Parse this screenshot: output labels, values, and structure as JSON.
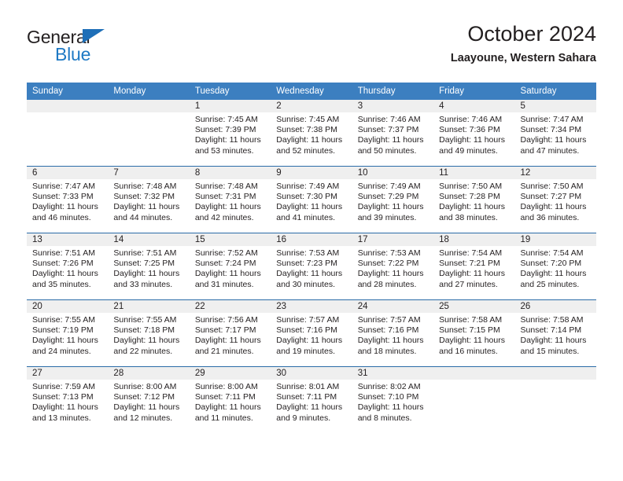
{
  "brand": {
    "name_part1": "General",
    "name_part2": "Blue",
    "accent_color": "#1e79c4",
    "triangle_color": "#1e6fb8"
  },
  "header": {
    "title": "October 2024",
    "subtitle": "Laayoune, Western Sahara"
  },
  "theme": {
    "header_row_bg": "#3c7fc0",
    "row_divider": "#2b6ca8",
    "day_strip_bg": "#efefef",
    "text": "#231f20"
  },
  "weekdays": [
    "Sunday",
    "Monday",
    "Tuesday",
    "Wednesday",
    "Thursday",
    "Friday",
    "Saturday"
  ],
  "weeks": [
    [
      {
        "day": "",
        "sunrise": "",
        "sunset": "",
        "daylight_line1": "",
        "daylight_line2": ""
      },
      {
        "day": "",
        "sunrise": "",
        "sunset": "",
        "daylight_line1": "",
        "daylight_line2": ""
      },
      {
        "day": "1",
        "sunrise": "Sunrise: 7:45 AM",
        "sunset": "Sunset: 7:39 PM",
        "daylight_line1": "Daylight: 11 hours",
        "daylight_line2": "and 53 minutes."
      },
      {
        "day": "2",
        "sunrise": "Sunrise: 7:45 AM",
        "sunset": "Sunset: 7:38 PM",
        "daylight_line1": "Daylight: 11 hours",
        "daylight_line2": "and 52 minutes."
      },
      {
        "day": "3",
        "sunrise": "Sunrise: 7:46 AM",
        "sunset": "Sunset: 7:37 PM",
        "daylight_line1": "Daylight: 11 hours",
        "daylight_line2": "and 50 minutes."
      },
      {
        "day": "4",
        "sunrise": "Sunrise: 7:46 AM",
        "sunset": "Sunset: 7:36 PM",
        "daylight_line1": "Daylight: 11 hours",
        "daylight_line2": "and 49 minutes."
      },
      {
        "day": "5",
        "sunrise": "Sunrise: 7:47 AM",
        "sunset": "Sunset: 7:34 PM",
        "daylight_line1": "Daylight: 11 hours",
        "daylight_line2": "and 47 minutes."
      }
    ],
    [
      {
        "day": "6",
        "sunrise": "Sunrise: 7:47 AM",
        "sunset": "Sunset: 7:33 PM",
        "daylight_line1": "Daylight: 11 hours",
        "daylight_line2": "and 46 minutes."
      },
      {
        "day": "7",
        "sunrise": "Sunrise: 7:48 AM",
        "sunset": "Sunset: 7:32 PM",
        "daylight_line1": "Daylight: 11 hours",
        "daylight_line2": "and 44 minutes."
      },
      {
        "day": "8",
        "sunrise": "Sunrise: 7:48 AM",
        "sunset": "Sunset: 7:31 PM",
        "daylight_line1": "Daylight: 11 hours",
        "daylight_line2": "and 42 minutes."
      },
      {
        "day": "9",
        "sunrise": "Sunrise: 7:49 AM",
        "sunset": "Sunset: 7:30 PM",
        "daylight_line1": "Daylight: 11 hours",
        "daylight_line2": "and 41 minutes."
      },
      {
        "day": "10",
        "sunrise": "Sunrise: 7:49 AM",
        "sunset": "Sunset: 7:29 PM",
        "daylight_line1": "Daylight: 11 hours",
        "daylight_line2": "and 39 minutes."
      },
      {
        "day": "11",
        "sunrise": "Sunrise: 7:50 AM",
        "sunset": "Sunset: 7:28 PM",
        "daylight_line1": "Daylight: 11 hours",
        "daylight_line2": "and 38 minutes."
      },
      {
        "day": "12",
        "sunrise": "Sunrise: 7:50 AM",
        "sunset": "Sunset: 7:27 PM",
        "daylight_line1": "Daylight: 11 hours",
        "daylight_line2": "and 36 minutes."
      }
    ],
    [
      {
        "day": "13",
        "sunrise": "Sunrise: 7:51 AM",
        "sunset": "Sunset: 7:26 PM",
        "daylight_line1": "Daylight: 11 hours",
        "daylight_line2": "and 35 minutes."
      },
      {
        "day": "14",
        "sunrise": "Sunrise: 7:51 AM",
        "sunset": "Sunset: 7:25 PM",
        "daylight_line1": "Daylight: 11 hours",
        "daylight_line2": "and 33 minutes."
      },
      {
        "day": "15",
        "sunrise": "Sunrise: 7:52 AM",
        "sunset": "Sunset: 7:24 PM",
        "daylight_line1": "Daylight: 11 hours",
        "daylight_line2": "and 31 minutes."
      },
      {
        "day": "16",
        "sunrise": "Sunrise: 7:53 AM",
        "sunset": "Sunset: 7:23 PM",
        "daylight_line1": "Daylight: 11 hours",
        "daylight_line2": "and 30 minutes."
      },
      {
        "day": "17",
        "sunrise": "Sunrise: 7:53 AM",
        "sunset": "Sunset: 7:22 PM",
        "daylight_line1": "Daylight: 11 hours",
        "daylight_line2": "and 28 minutes."
      },
      {
        "day": "18",
        "sunrise": "Sunrise: 7:54 AM",
        "sunset": "Sunset: 7:21 PM",
        "daylight_line1": "Daylight: 11 hours",
        "daylight_line2": "and 27 minutes."
      },
      {
        "day": "19",
        "sunrise": "Sunrise: 7:54 AM",
        "sunset": "Sunset: 7:20 PM",
        "daylight_line1": "Daylight: 11 hours",
        "daylight_line2": "and 25 minutes."
      }
    ],
    [
      {
        "day": "20",
        "sunrise": "Sunrise: 7:55 AM",
        "sunset": "Sunset: 7:19 PM",
        "daylight_line1": "Daylight: 11 hours",
        "daylight_line2": "and 24 minutes."
      },
      {
        "day": "21",
        "sunrise": "Sunrise: 7:55 AM",
        "sunset": "Sunset: 7:18 PM",
        "daylight_line1": "Daylight: 11 hours",
        "daylight_line2": "and 22 minutes."
      },
      {
        "day": "22",
        "sunrise": "Sunrise: 7:56 AM",
        "sunset": "Sunset: 7:17 PM",
        "daylight_line1": "Daylight: 11 hours",
        "daylight_line2": "and 21 minutes."
      },
      {
        "day": "23",
        "sunrise": "Sunrise: 7:57 AM",
        "sunset": "Sunset: 7:16 PM",
        "daylight_line1": "Daylight: 11 hours",
        "daylight_line2": "and 19 minutes."
      },
      {
        "day": "24",
        "sunrise": "Sunrise: 7:57 AM",
        "sunset": "Sunset: 7:16 PM",
        "daylight_line1": "Daylight: 11 hours",
        "daylight_line2": "and 18 minutes."
      },
      {
        "day": "25",
        "sunrise": "Sunrise: 7:58 AM",
        "sunset": "Sunset: 7:15 PM",
        "daylight_line1": "Daylight: 11 hours",
        "daylight_line2": "and 16 minutes."
      },
      {
        "day": "26",
        "sunrise": "Sunrise: 7:58 AM",
        "sunset": "Sunset: 7:14 PM",
        "daylight_line1": "Daylight: 11 hours",
        "daylight_line2": "and 15 minutes."
      }
    ],
    [
      {
        "day": "27",
        "sunrise": "Sunrise: 7:59 AM",
        "sunset": "Sunset: 7:13 PM",
        "daylight_line1": "Daylight: 11 hours",
        "daylight_line2": "and 13 minutes."
      },
      {
        "day": "28",
        "sunrise": "Sunrise: 8:00 AM",
        "sunset": "Sunset: 7:12 PM",
        "daylight_line1": "Daylight: 11 hours",
        "daylight_line2": "and 12 minutes."
      },
      {
        "day": "29",
        "sunrise": "Sunrise: 8:00 AM",
        "sunset": "Sunset: 7:11 PM",
        "daylight_line1": "Daylight: 11 hours",
        "daylight_line2": "and 11 minutes."
      },
      {
        "day": "30",
        "sunrise": "Sunrise: 8:01 AM",
        "sunset": "Sunset: 7:11 PM",
        "daylight_line1": "Daylight: 11 hours",
        "daylight_line2": "and 9 minutes."
      },
      {
        "day": "31",
        "sunrise": "Sunrise: 8:02 AM",
        "sunset": "Sunset: 7:10 PM",
        "daylight_line1": "Daylight: 11 hours",
        "daylight_line2": "and 8 minutes."
      },
      {
        "day": "",
        "sunrise": "",
        "sunset": "",
        "daylight_line1": "",
        "daylight_line2": ""
      },
      {
        "day": "",
        "sunrise": "",
        "sunset": "",
        "daylight_line1": "",
        "daylight_line2": ""
      }
    ]
  ]
}
